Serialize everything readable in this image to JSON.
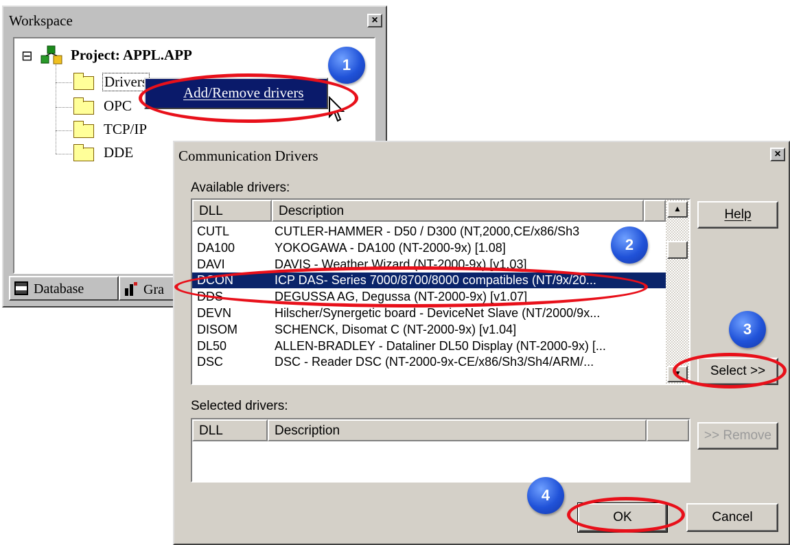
{
  "workspace": {
    "title": "Workspace",
    "close": "×",
    "tree_toggle": "⊟",
    "project_label": "Project: APPL.APP",
    "folders": [
      "Drivers",
      "OPC",
      "TCP/IP",
      "DDE"
    ],
    "tabs": [
      "Database",
      "Gra"
    ],
    "context_menu": {
      "item": "Add/Remove drivers"
    }
  },
  "dialog": {
    "title": "Communication Drivers",
    "close": "×",
    "available_label": "Available drivers:",
    "selected_label": "Selected drivers:",
    "columns": {
      "dll": "DLL",
      "description": "Description"
    },
    "available_rows": [
      {
        "dll": "CUTL",
        "description": "CUTLER-HAMMER - D50 / D300 (NT,2000,CE/x86/Sh3"
      },
      {
        "dll": "DA100",
        "description": "YOKOGAWA - DA100 (NT-2000-9x) [1.08]"
      },
      {
        "dll": "DAVI",
        "description": "DAVIS - Weather Wizard (NT-2000-9x) [v1.03]"
      },
      {
        "dll": "DCON",
        "description": "ICP DAS- Series 7000/8700/8000 compatibles (NT/9x/20..."
      },
      {
        "dll": "DDS",
        "description": "DEGUSSA AG, Degussa (NT-2000-9x) [v1.07]"
      },
      {
        "dll": "DEVN",
        "description": "Hilscher/Synergetic board - DeviceNet Slave (NT/2000/9x..."
      },
      {
        "dll": "DISOM",
        "description": "SCHENCK, Disomat C (NT-2000-9x) [v1.04]"
      },
      {
        "dll": "DL50",
        "description": "ALLEN-BRADLEY - Dataliner DL50 Display (NT-2000-9x) [..."
      },
      {
        "dll": "DSC",
        "description": "DSC  - Reader DSC (NT-2000-9x-CE/x86/Sh3/Sh4/ARM/..."
      }
    ],
    "buttons": {
      "help": "Help",
      "select": "Select >>",
      "remove": ">> Remove",
      "ok": "OK",
      "cancel": "Cancel"
    }
  },
  "steps": [
    "1",
    "2",
    "3",
    "4"
  ],
  "colors": {
    "highlight": "#0a246a",
    "annotation_ring": "#e8101a",
    "badge": "#2052d8"
  }
}
